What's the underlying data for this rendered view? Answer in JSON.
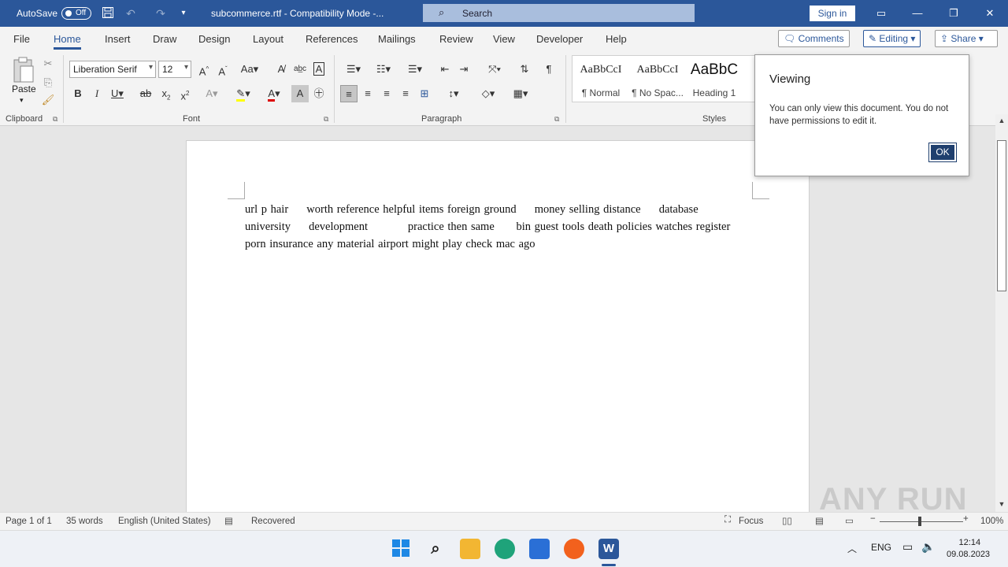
{
  "titlebar": {
    "autosave_label": "AutoSave",
    "autosave_state": "Off",
    "document_title": "subcommerce.rtf  -  Compatibility Mode  -...",
    "search_placeholder": "Search",
    "signin_label": "Sign in"
  },
  "menu": {
    "tabs": [
      "File",
      "Home",
      "Insert",
      "Draw",
      "Design",
      "Layout",
      "References",
      "Mailings",
      "Review",
      "View",
      "Developer",
      "Help"
    ],
    "active_tab": "Home",
    "comments_label": "Comments",
    "editing_label": "Editing",
    "share_label": "Share"
  },
  "ribbon": {
    "paste_label": "Paste",
    "font_name": "Liberation Serif",
    "font_size": "12",
    "groups": {
      "clipboard": "Clipboard",
      "font": "Font",
      "paragraph": "Paragraph",
      "styles": "Styles"
    },
    "styles": [
      {
        "sample": "AaBbCcI",
        "name": "¶ Normal"
      },
      {
        "sample": "AaBbCcI",
        "name": "¶ No Spac..."
      },
      {
        "sample": "AaBbC",
        "name": "Heading 1"
      }
    ]
  },
  "document": {
    "line1": "url p hair     worth reference helpful items foreign ground     money selling distance     database",
    "line2": "university     development           practice then same      bin guest tools death policies watches register",
    "line3": "porn insurance any material airport might play check mac ago"
  },
  "popup": {
    "title": "Viewing",
    "message": "You can only view this document. You do not have permissions to edit it.",
    "ok_label": "OK"
  },
  "statusbar": {
    "page": "Page 1 of 1",
    "words": "35 words",
    "language": "English (United States)",
    "recovered": "Recovered",
    "focus": "Focus",
    "zoom": "100%"
  },
  "taskbar": {
    "lang": "ENG",
    "time": "12:14",
    "date": "09.08.2023"
  },
  "watermark": "ANY RUN",
  "colors": {
    "accent": "#2b579a",
    "ok_button": "#1f3f6e"
  }
}
